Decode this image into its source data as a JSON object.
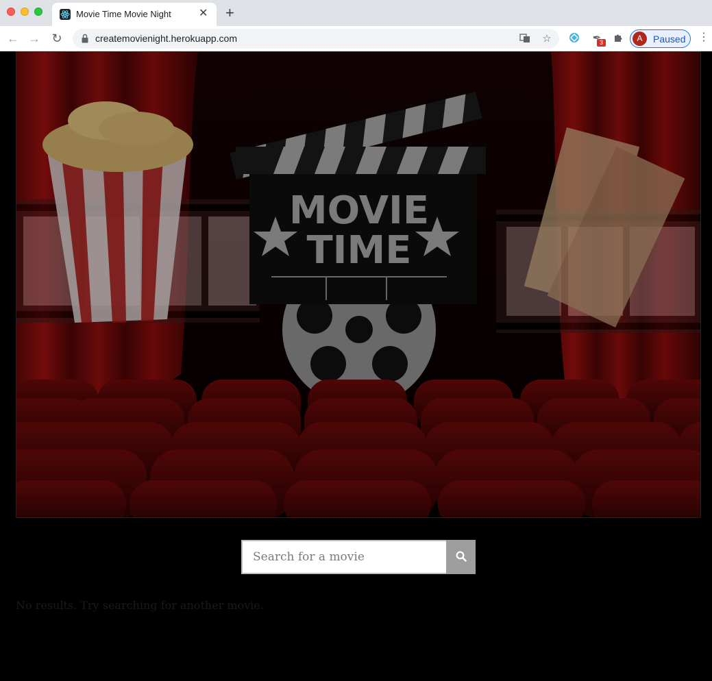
{
  "browser": {
    "tab_title": "Movie Time Movie Night",
    "url": "createmovienight.herokuapp.com",
    "extension_badge": "3",
    "profile_initial": "A",
    "profile_status": "Paused"
  },
  "hero": {
    "title_line1": "MOVIE",
    "title_line2": "TIME"
  },
  "search": {
    "placeholder": "Search for a movie"
  },
  "results": {
    "empty_message": "No results. Try searching for another movie."
  },
  "colors": {
    "page_background": "#000000",
    "curtain_red": "#8b0a0a",
    "seat_red": "#4a0606",
    "search_button": "#9e9e9e"
  }
}
